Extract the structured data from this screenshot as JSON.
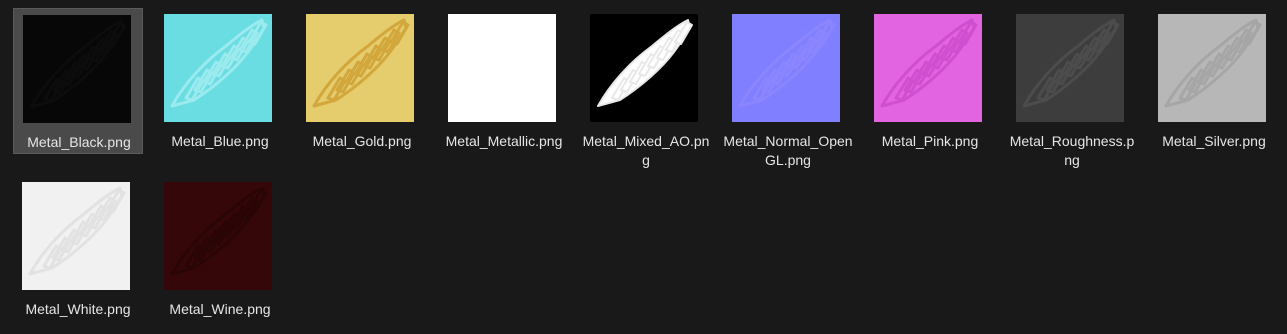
{
  "files": [
    {
      "name": "Metal_Black.png",
      "bg": "#070707",
      "wing": "#0c0c0c",
      "fill": "none",
      "selected": true
    },
    {
      "name": "Metal_Blue.png",
      "bg": "#69dde2",
      "wing": "#9aeaee",
      "fill": "none",
      "selected": false
    },
    {
      "name": "Metal_Gold.png",
      "bg": "#e5cc6c",
      "wing": "#d2a73c",
      "fill": "none",
      "selected": false
    },
    {
      "name": "Metal_Metallic.png",
      "bg": "#ffffff",
      "wing": "#ffffff",
      "fill": "none",
      "selected": false
    },
    {
      "name": "Metal_Mixed_AO.png",
      "bg": "#000000",
      "wing": "#e8e8e8",
      "fill": "#ffffff",
      "selected": false
    },
    {
      "name": "Metal_Normal_OpenGL.png",
      "bg": "#7f7fff",
      "wing": "#8b86ff",
      "fill": "none",
      "selected": false
    },
    {
      "name": "Metal_Pink.png",
      "bg": "#e364e0",
      "wing": "#d04ed0",
      "fill": "none",
      "selected": false
    },
    {
      "name": "Metal_Roughness.png",
      "bg": "#3d3d3d",
      "wing": "#4c4c4c",
      "fill": "none",
      "selected": false
    },
    {
      "name": "Metal_Silver.png",
      "bg": "#b7b7b7",
      "wing": "#a6a6a6",
      "fill": "none",
      "selected": false
    },
    {
      "name": "Metal_White.png",
      "bg": "#f1f1f1",
      "wing": "#e2e2e2",
      "fill": "none",
      "selected": false
    },
    {
      "name": "Metal_Wine.png",
      "bg": "#360709",
      "wing": "#2a0506",
      "fill": "none",
      "selected": false
    }
  ]
}
